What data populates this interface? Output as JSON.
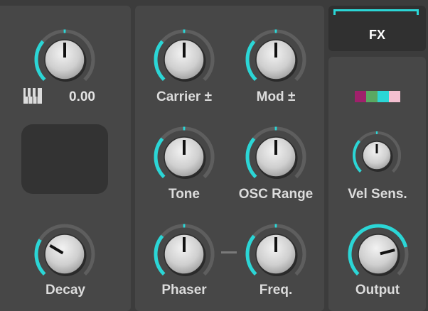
{
  "colors": {
    "accent": "#2bd6d6",
    "track": "#5e5e5e",
    "panel": "#474747",
    "background": "#3c3c3c"
  },
  "fx": {
    "label": "FX"
  },
  "keyboard": {
    "icon": "piano-keys-icon",
    "value": "0.00"
  },
  "knobs": {
    "pitch": {
      "label": "",
      "value": 0.5
    },
    "decay": {
      "label": "Decay",
      "value": 0.28
    },
    "carrier": {
      "label": "Carrier ±",
      "value": 0.5
    },
    "mod": {
      "label": "Mod ±",
      "value": 0.5
    },
    "tone": {
      "label": "Tone",
      "value": 0.5
    },
    "osc_range": {
      "label": "OSC Range",
      "value": 0.5
    },
    "phaser": {
      "label": "Phaser",
      "value": 0.5
    },
    "freq": {
      "label": "Freq.",
      "value": 0.5
    },
    "vel_sens": {
      "label": "Vel Sens.",
      "value": 0.5
    },
    "output": {
      "label": "Output",
      "value": 0.78
    }
  },
  "swatches": [
    "#a0206b",
    "#5aa862",
    "#2bd6d6",
    "#f3bfd0"
  ]
}
